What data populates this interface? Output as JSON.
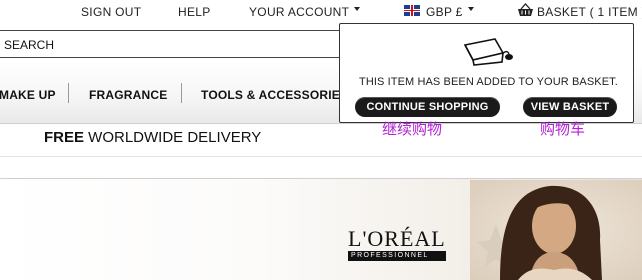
{
  "topbar": {
    "sign_out": "SIGN OUT",
    "help": "HELP",
    "your_account": "YOUR ACCOUNT",
    "currency": "GBP £",
    "basket": "BASKET ( 1 ITEM )"
  },
  "search": {
    "placeholder": "SEARCH"
  },
  "nav": {
    "items": [
      {
        "label": "MAKE UP"
      },
      {
        "label": "FRAGRANCE"
      },
      {
        "label": "TOOLS & ACCESSORIES"
      }
    ]
  },
  "promo": {
    "bold": "FREE",
    "text": " WORLDWIDE DELIVERY"
  },
  "banner": {
    "brand": "L'ORÉAL",
    "brand_sub": "PROFESSIONNEL"
  },
  "popup": {
    "message": "THIS ITEM HAS BEEN ADDED TO YOUR BASKET.",
    "continue_label": "CONTINUE SHOPPING",
    "view_label": "VIEW BASKET",
    "continue_annotation": "继续购物",
    "view_annotation": "购物车"
  },
  "icons": {
    "flag": "uk-flag-icon",
    "basket": "basket-icon",
    "added_item": "shopping-bag-icon"
  },
  "colors": {
    "annotation": "#b321d6",
    "button": "#1a1a1a"
  }
}
